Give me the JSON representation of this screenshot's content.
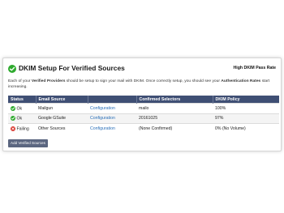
{
  "header": {
    "title": "DKIM Setup For Verified Sources",
    "pass_rate_label": "High DKIM Pass Rate"
  },
  "description": {
    "p1": "Each of your ",
    "b1": "Verified Providers",
    "p2": " should be setup to sign your mail with DKIM. Once correctly setup, you should see your ",
    "b2": "Authentication Rates",
    "p3": " start increasing."
  },
  "table": {
    "columns": [
      "Status",
      "Email Source",
      "",
      "Confirmed Selectors",
      "DKIM Policy"
    ],
    "rows": [
      {
        "status_icon": "check-circle-icon",
        "status": "Ok",
        "source": "Mailgun",
        "action": "Configuration",
        "selectors": "mailo",
        "policy": "100%"
      },
      {
        "status_icon": "check-circle-icon",
        "status": "Ok",
        "source": "Google GSuite",
        "action": "Configuration",
        "selectors": "20161025",
        "policy": "97%"
      },
      {
        "status_icon": "x-circle-icon",
        "status": "Failing",
        "source": "Other Sources",
        "action": "Configuration",
        "selectors": "(None Confirmed)",
        "policy": "0% (No Volume)"
      }
    ]
  },
  "add_button": "Add Verified Sources",
  "colors": {
    "ok": "#2eaa2e",
    "fail": "#d8332b",
    "header_bg": "#3f4f74",
    "link": "#2a6fb8"
  }
}
